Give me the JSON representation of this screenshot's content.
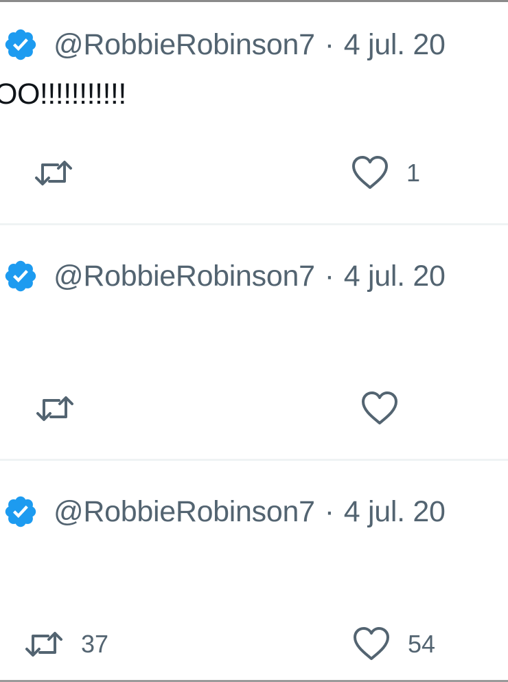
{
  "tweets": [
    {
      "handle": "@RobbieRobinson7",
      "separator": "·",
      "date": "4 jul. 20",
      "text": "OO!!!!!!!!!!!",
      "retweet_count": "",
      "like_count": "1"
    },
    {
      "handle": "@RobbieRobinson7",
      "separator": "·",
      "date": "4 jul. 20",
      "text": "",
      "retweet_count": "",
      "like_count": ""
    },
    {
      "handle": "@RobbieRobinson7",
      "separator": "·",
      "date": "4 jul. 20",
      "text": "",
      "retweet_count": "37",
      "like_count": "54"
    }
  ],
  "colors": {
    "verified_blue": "#1d9bf0",
    "muted_text": "#536471",
    "divider": "#eff3f4"
  },
  "icons": {
    "verified": "verified-badge-icon",
    "retweet": "retweet-icon",
    "like": "heart-icon"
  }
}
